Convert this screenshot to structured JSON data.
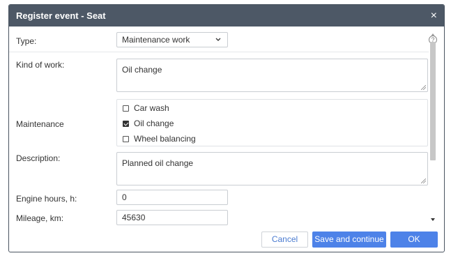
{
  "dialog": {
    "title": "Register event - Seat",
    "close_symbol": "×"
  },
  "fields": {
    "type_label": "Type:",
    "type_value": "Maintenance work",
    "help_symbol": "?",
    "kind_label": "Kind of work:",
    "kind_value": "Oil change",
    "maintenance_label": "Maintenance",
    "maintenance_options": [
      {
        "label": "Car wash",
        "checked": false
      },
      {
        "label": "Oil change",
        "checked": true
      },
      {
        "label": "Wheel balancing",
        "checked": false
      }
    ],
    "description_label": "Description:",
    "description_value": "Planned oil change",
    "engine_hours_label": "Engine hours, h:",
    "engine_hours_value": "0",
    "mileage_label": "Mileage, km:",
    "mileage_value": "45630"
  },
  "footer": {
    "cancel_label": "Cancel",
    "save_continue_label": "Save and continue",
    "ok_label": "OK"
  },
  "colors": {
    "titlebar": "#4d5866",
    "primary_button": "#4d82e8",
    "link_text": "#4a7bd0"
  }
}
